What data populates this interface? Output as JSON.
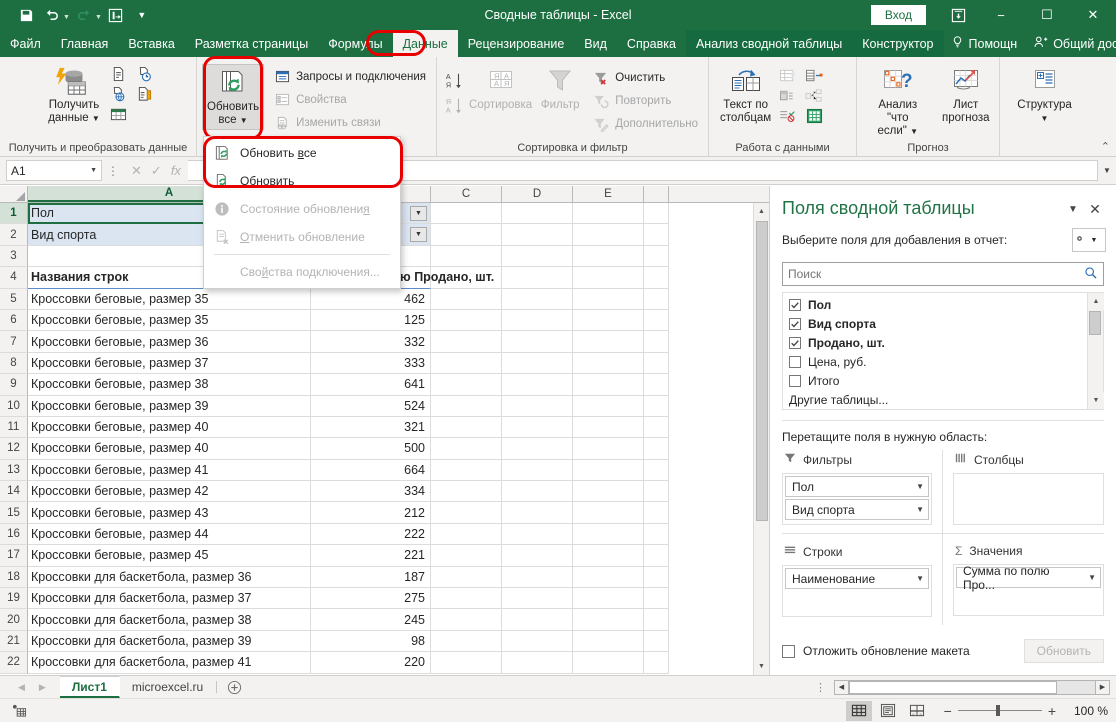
{
  "titlebar": {
    "quick_access": [
      "save-icon",
      "undo-icon",
      "redo-icon",
      "pivot-icon",
      "customize-icon"
    ],
    "document_title": "Сводные таблицы  -  Excel",
    "sign_in": "Вход",
    "ribbon_display_icon": "ribbon-display-options-icon",
    "minimize": "−",
    "maximize": "☐",
    "close": "✕"
  },
  "tabs": [
    {
      "label": "Файл",
      "state": "normal"
    },
    {
      "label": "Главная",
      "state": "normal"
    },
    {
      "label": "Вставка",
      "state": "normal"
    },
    {
      "label": "Разметка страницы",
      "state": "normal"
    },
    {
      "label": "Формулы",
      "state": "normal"
    },
    {
      "label": "Данные",
      "state": "active"
    },
    {
      "label": "Рецензирование",
      "state": "normal"
    },
    {
      "label": "Вид",
      "state": "normal"
    },
    {
      "label": "Справка",
      "state": "normal"
    },
    {
      "label": "Анализ сводной таблицы",
      "state": "contextual"
    },
    {
      "label": "Конструктор",
      "state": "contextual"
    }
  ],
  "tab_tools": [
    {
      "label": "Помощн",
      "icon": "lightbulb-icon"
    },
    {
      "label": "Общий доступ",
      "icon": "share-person-icon"
    }
  ],
  "ribbon": {
    "groups": [
      {
        "name": "Получить и преобразовать данные",
        "big_button": {
          "label_line1": "Получить",
          "label_line2": "данные",
          "has_caret": true
        },
        "small_buttons": [
          {
            "label": "",
            "icon": "from-text-icon"
          },
          {
            "label": "",
            "icon": "recent-sources-icon"
          },
          {
            "label": "",
            "icon": "from-web-icon"
          },
          {
            "label": "",
            "icon": "existing-connections-icon"
          },
          {
            "label": "",
            "icon": "from-table-icon"
          }
        ]
      },
      {
        "name": "Запросы и подключения",
        "big_button": {
          "label_line1": "Обновить",
          "label_line2": "все",
          "has_caret": true,
          "pressed": true,
          "highlighted": true
        },
        "small_buttons": [
          {
            "label": "Запросы и подключения",
            "icon": "queries-connections-icon",
            "disabled": false
          },
          {
            "label": "Свойства",
            "icon": "properties-icon",
            "disabled": true
          },
          {
            "label": "Изменить связи",
            "icon": "edit-links-icon",
            "disabled": true
          }
        ]
      },
      {
        "name": "Сортировка и фильтр",
        "sort_az": "А Я ↓",
        "sort_za": "Я А ↓",
        "sort_button": "Сортировка",
        "filter_button": "Фильтр",
        "small_buttons": [
          {
            "label": "Очистить",
            "icon": "clear-filter-icon",
            "disabled": false
          },
          {
            "label": "Повторить",
            "icon": "reapply-icon",
            "disabled": true
          },
          {
            "label": "Дополнительно",
            "icon": "advanced-filter-icon",
            "disabled": true
          }
        ]
      },
      {
        "name": "Работа с данными",
        "big_button": {
          "label_line1": "Текст по",
          "label_line2": "столбцам"
        },
        "small_buttons": [
          {
            "icon": "flash-fill-icon"
          },
          {
            "icon": "remove-duplicates-icon"
          },
          {
            "icon": "data-validation-icon"
          },
          {
            "icon": "consolidate-icon"
          },
          {
            "icon": "relationships-icon"
          },
          {
            "icon": "data-model-icon"
          }
        ]
      },
      {
        "name": "Прогноз",
        "buttons": [
          {
            "label_line1": "Анализ \"что",
            "label_line2": "если\"",
            "has_caret": true,
            "icon": "what-if-icon"
          },
          {
            "label_line1": "Лист",
            "label_line2": "прогноза",
            "icon": "forecast-sheet-icon"
          }
        ]
      },
      {
        "name": "",
        "buttons": [
          {
            "label_line1": "Структура",
            "label_line2": "",
            "has_caret": true,
            "icon": "outline-icon"
          }
        ]
      }
    ],
    "collapse_icon": "chevron-up-icon"
  },
  "dropdown_menu": {
    "items": [
      {
        "label_before": "Обновить ",
        "underlined": "в",
        "label_after": "се",
        "icon": "refresh-all-icon",
        "disabled": false,
        "highlighted": true
      },
      {
        "label_before": "",
        "underlined": "О",
        "label_after": "бновить",
        "icon": "refresh-icon",
        "disabled": false,
        "highlighted": true
      },
      {
        "label_before": "Состояние обновлени",
        "underlined": "я",
        "label_after": "",
        "icon": "info-icon",
        "disabled": true
      },
      {
        "label_before": "",
        "underlined": "О",
        "label_after": "тменить обновление",
        "icon": "cancel-refresh-icon",
        "disabled": true
      },
      {
        "label_before": "Сво",
        "underlined": "й",
        "label_after": "ства подключения...",
        "icon": "",
        "disabled": true
      }
    ]
  },
  "formula_bar": {
    "name_box": "A1",
    "cancel_icon": "x-icon",
    "confirm_icon": "check-icon",
    "fx_icon": "fx-icon",
    "value": "",
    "expand_icon": "chevron-down-icon"
  },
  "grid": {
    "columns": [
      "A",
      "B",
      "C",
      "D",
      "E"
    ],
    "selected_column": "A",
    "selected_cell": "A1",
    "rows": [
      {
        "n": "1",
        "a": "Пол",
        "b": "",
        "type": "pivot-filter"
      },
      {
        "n": "2",
        "a": "Вид спорта",
        "b": "",
        "type": "pivot-filter"
      },
      {
        "n": "3",
        "a": "",
        "b": "",
        "type": "blank"
      },
      {
        "n": "4",
        "a": "Названия строк",
        "b": "Сумма по полю Продано, шт.",
        "type": "header"
      },
      {
        "n": "5",
        "a": "Кроссовки беговые, размер 35",
        "b": "462",
        "type": "data"
      },
      {
        "n": "6",
        "a": "Кроссовки беговые, размер 35",
        "b": "125",
        "type": "data"
      },
      {
        "n": "7",
        "a": "Кроссовки беговые, размер 36",
        "b": "332",
        "type": "data"
      },
      {
        "n": "8",
        "a": "Кроссовки беговые, размер 37",
        "b": "333",
        "type": "data"
      },
      {
        "n": "9",
        "a": "Кроссовки беговые, размер 38",
        "b": "641",
        "type": "data"
      },
      {
        "n": "10",
        "a": "Кроссовки беговые, размер 39",
        "b": "524",
        "type": "data"
      },
      {
        "n": "11",
        "a": "Кроссовки беговые, размер 40",
        "b": "321",
        "type": "data"
      },
      {
        "n": "12",
        "a": "Кроссовки беговые, размер 40",
        "b": "500",
        "type": "data"
      },
      {
        "n": "13",
        "a": "Кроссовки беговые, размер 41",
        "b": "664",
        "type": "data"
      },
      {
        "n": "14",
        "a": "Кроссовки беговые, размер 42",
        "b": "334",
        "type": "data"
      },
      {
        "n": "15",
        "a": "Кроссовки беговые, размер 43",
        "b": "212",
        "type": "data"
      },
      {
        "n": "16",
        "a": "Кроссовки беговые, размер 44",
        "b": "222",
        "type": "data"
      },
      {
        "n": "17",
        "a": "Кроссовки беговые, размер 45",
        "b": "221",
        "type": "data"
      },
      {
        "n": "18",
        "a": "Кроссовки для баскетбола, размер 36",
        "b": "187",
        "type": "data"
      },
      {
        "n": "19",
        "a": "Кроссовки для баскетбола, размер 37",
        "b": "275",
        "type": "data"
      },
      {
        "n": "20",
        "a": "Кроссовки для баскетбола, размер 38",
        "b": "245",
        "type": "data"
      },
      {
        "n": "21",
        "a": "Кроссовки для баскетбола, размер 39",
        "b": "98",
        "type": "data"
      },
      {
        "n": "22",
        "a": "Кроссовки для баскетбола, размер 41",
        "b": "220",
        "type": "data"
      }
    ]
  },
  "pivot_panel": {
    "title": "Поля сводной таблицы",
    "collapse_icon": "chevron-down-icon",
    "close_icon": "close-icon",
    "subtitle": "Выберите поля для добавления в отчет:",
    "gear_icon": "gear-icon",
    "search_placeholder": "Поиск",
    "search_value": "",
    "search_icon": "search-icon",
    "fields": [
      {
        "label": "Пол",
        "checked": true,
        "bold": true
      },
      {
        "label": "Вид спорта",
        "checked": true,
        "bold": true
      },
      {
        "label": "Продано, шт.",
        "checked": true,
        "bold": true
      },
      {
        "label": "Цена, руб.",
        "checked": false,
        "bold": false
      },
      {
        "label": "Итого",
        "checked": false,
        "bold": false
      }
    ],
    "more_tables": "Другие таблицы...",
    "drag_label": "Перетащите поля в нужную область:",
    "areas": [
      {
        "name": "Фильтры",
        "icon": "filter-icon",
        "items": [
          "Пол",
          "Вид спорта"
        ]
      },
      {
        "name": "Столбцы",
        "icon": "columns-icon",
        "items": []
      },
      {
        "name": "Строки",
        "icon": "rows-icon",
        "items": [
          "Наименование"
        ]
      },
      {
        "name": "Значения",
        "icon": "sigma-icon",
        "items": [
          "Сумма по полю Про..."
        ]
      }
    ],
    "defer_label": "Отложить обновление макета",
    "defer_checked": false,
    "update_button": "Обновить"
  },
  "sheet_tabs": {
    "prev_icon": "chevron-left-icon",
    "next_icon": "chevron-right-icon",
    "tabs": [
      {
        "label": "Лист1",
        "active": true
      },
      {
        "label": "microexcel.ru",
        "active": false
      }
    ],
    "add_icon": "plus-circle-icon"
  },
  "status_bar": {
    "mode_icon": "accessibility-icon",
    "views": [
      {
        "icon": "normal-view-icon",
        "active": true
      },
      {
        "icon": "page-layout-view-icon",
        "active": false
      },
      {
        "icon": "page-break-view-icon",
        "active": false
      }
    ],
    "zoom_out": "−",
    "zoom_in": "+",
    "zoom_level": "100 %"
  },
  "colors": {
    "brand_green": "#1d6f42",
    "accent_green": "#217346",
    "highlight_red": "#e80000",
    "pivot_filter_blue": "#dbe5f1",
    "ribbon_bg": "#f3f2f1"
  }
}
